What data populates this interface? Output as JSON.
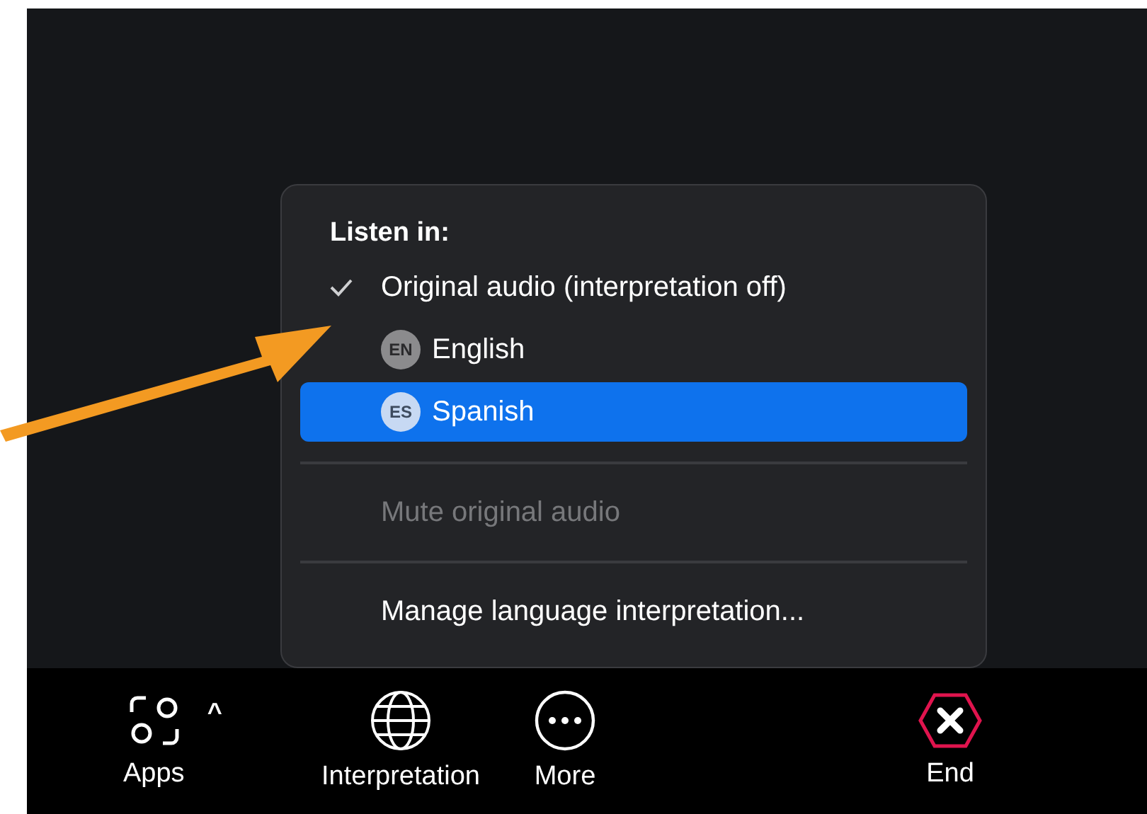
{
  "menu": {
    "heading": "Listen in:",
    "items": [
      {
        "kind": "option",
        "label": "Original audio (interpretation off)",
        "checked": true,
        "selected": false
      },
      {
        "kind": "option",
        "label": "English",
        "badge": "EN",
        "checked": false,
        "selected": false
      },
      {
        "kind": "option",
        "label": "Spanish",
        "badge": "ES",
        "checked": false,
        "selected": true
      },
      {
        "kind": "divider"
      },
      {
        "kind": "action",
        "label": "Mute original audio",
        "disabled": true
      },
      {
        "kind": "divider"
      },
      {
        "kind": "action",
        "label": "Manage language interpretation...",
        "disabled": false
      }
    ]
  },
  "toolbar": {
    "items": [
      {
        "kind": "apps",
        "label": "Apps",
        "caret": "^"
      },
      {
        "kind": "interpretation",
        "label": "Interpretation"
      },
      {
        "kind": "more",
        "label": "More"
      },
      {
        "kind": "end",
        "label": "End"
      }
    ]
  }
}
